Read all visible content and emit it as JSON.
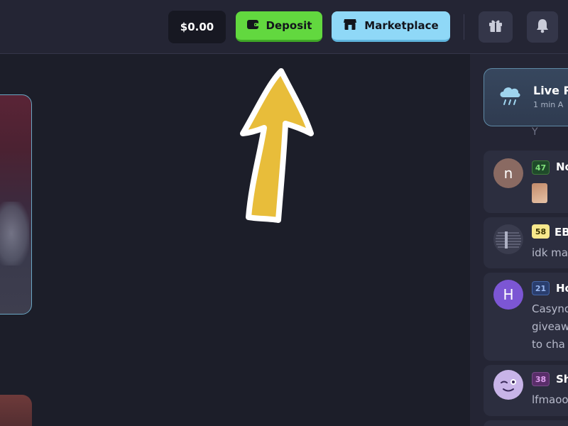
{
  "header": {
    "balance": "$0.00",
    "deposit_label": "Deposit",
    "marketplace_label": "Marketplace",
    "gift_icon": "gift-icon",
    "bell_icon": "bell-icon"
  },
  "colors": {
    "deposit": "#62d83f",
    "marketplace": "#8fd8f7",
    "arrow": "#e8bd3a"
  },
  "chat": {
    "live": {
      "title": "Live R",
      "subtitle": "1 min A"
    },
    "partial_text": "Y",
    "messages": [
      {
        "avatar_letter": "n",
        "avatar_color": "#8a6a62",
        "level": "47",
        "name": "No",
        "text": ""
      },
      {
        "avatar_letter": "",
        "avatar_color": "#3a3c4e",
        "level": "58",
        "name": "EB",
        "text": "idk ma"
      },
      {
        "avatar_letter": "H",
        "avatar_color": "#7c56d4",
        "level": "21",
        "name": "Ho",
        "text_lines": [
          "Casyno",
          "giveaw",
          "to cha"
        ]
      },
      {
        "avatar_letter": "",
        "avatar_color": "#c8b4e8",
        "level": "38",
        "name": "Sh",
        "text": "lfmaoo"
      }
    ]
  }
}
